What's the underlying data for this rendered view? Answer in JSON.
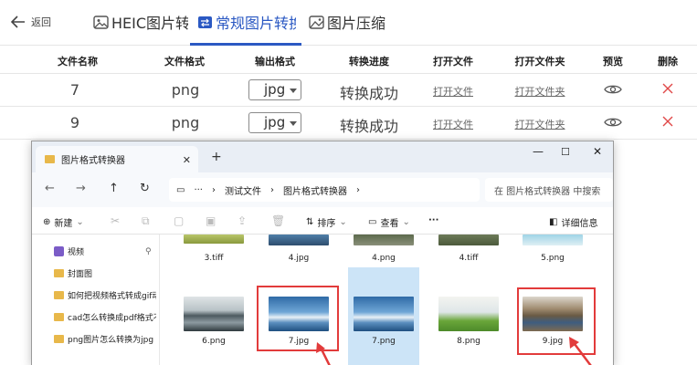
{
  "header": {
    "back_label": "返回",
    "tabs": [
      {
        "label": "HEIC图片转换",
        "active": false
      },
      {
        "label": "常规图片转换",
        "active": true
      },
      {
        "label": "图片压缩",
        "active": false
      }
    ],
    "accent": "#2b59c3"
  },
  "table": {
    "columns": [
      "文件名称",
      "文件格式",
      "输出格式",
      "转换进度",
      "打开文件",
      "打开文件夹",
      "预览",
      "删除"
    ],
    "rows": [
      {
        "name": "7",
        "format": "png",
        "output": "jpg",
        "progress": "转换成功",
        "open_file": "打开文件",
        "open_folder": "打开文件夹"
      },
      {
        "name": "9",
        "format": "png",
        "output": "jpg",
        "progress": "转换成功",
        "open_file": "打开文件",
        "open_folder": "打开文件夹"
      }
    ]
  },
  "explorer": {
    "tab_title": "图片格式转换器",
    "breadcrumb": [
      "测试文件",
      "图片格式转换器"
    ],
    "search_placeholder": "在 图片格式转换器 中搜索",
    "toolbar": {
      "new": "新建",
      "sort": "排序",
      "view": "查看",
      "details": "详细信息"
    },
    "sidebar": [
      "视频",
      "封面图",
      "如何把视频格式转成gif动",
      "cad怎么转换成pdf格式不",
      "png图片怎么转换为jpg"
    ],
    "files_top": [
      "3.tiff",
      "4.jpg",
      "4.png",
      "4.tiff",
      "5.png"
    ],
    "files_bottom": [
      "6.png",
      "7.jpg",
      "7.png",
      "8.png",
      "9.jpg"
    ],
    "highlight_color": "#e23b3b"
  }
}
